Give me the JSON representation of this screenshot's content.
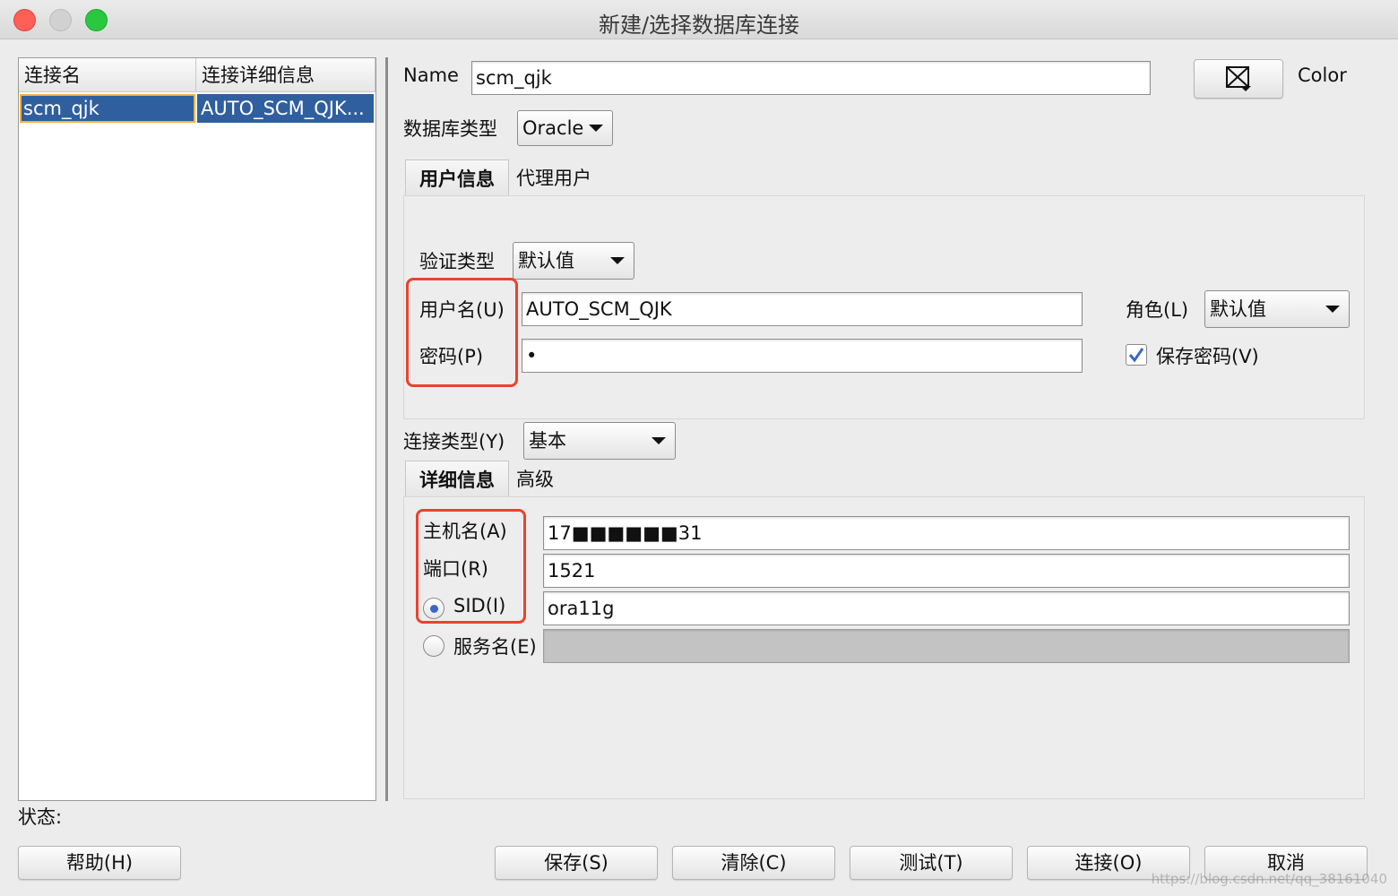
{
  "window": {
    "title": "新建/选择数据库连接"
  },
  "connections": {
    "columns": [
      "连接名",
      "连接详细信息"
    ],
    "rows": [
      {
        "name": "scm_qjk",
        "detail": "AUTO_SCM_QJK..."
      }
    ]
  },
  "form": {
    "name_label": "Name",
    "name_value": "scm_qjk",
    "color_label": "Color",
    "db_type_label": "数据库类型",
    "db_type_value": "Oracle",
    "tabs": [
      {
        "label": "用户信息"
      },
      {
        "label": "代理用户"
      }
    ],
    "auth_type_label": "验证类型",
    "auth_type_value": "默认值",
    "username_label": "用户名(U)",
    "username_value": "AUTO_SCM_QJK",
    "password_label": "密码(P)",
    "password_value": "•",
    "role_label": "角色(L)",
    "role_value": "默认值",
    "save_password_label": "保存密码(V)",
    "save_password_checked": true,
    "conn_type_label": "连接类型(Y)",
    "conn_type_value": "基本",
    "detail_tabs": [
      {
        "label": "详细信息"
      },
      {
        "label": "高级"
      }
    ],
    "host_label": "主机名(A)",
    "host_value": "17■■■■■■31",
    "port_label": "端口(R)",
    "port_value": "1521",
    "sid_label": "SID(I)",
    "sid_value": "ora11g",
    "service_label": "服务名(E)",
    "service_value": ""
  },
  "status": {
    "label": "状态:"
  },
  "buttons": {
    "help": "帮助(H)",
    "save": "保存(S)",
    "clear": "清除(C)",
    "test": "测试(T)",
    "connect": "连接(O)",
    "cancel": "取消"
  },
  "watermark": "https://blog.csdn.net/qq_38161040",
  "colors": {
    "selection": "#2f5f9e",
    "highlight_box": "#e8432f",
    "accent": "#3a66c9"
  }
}
